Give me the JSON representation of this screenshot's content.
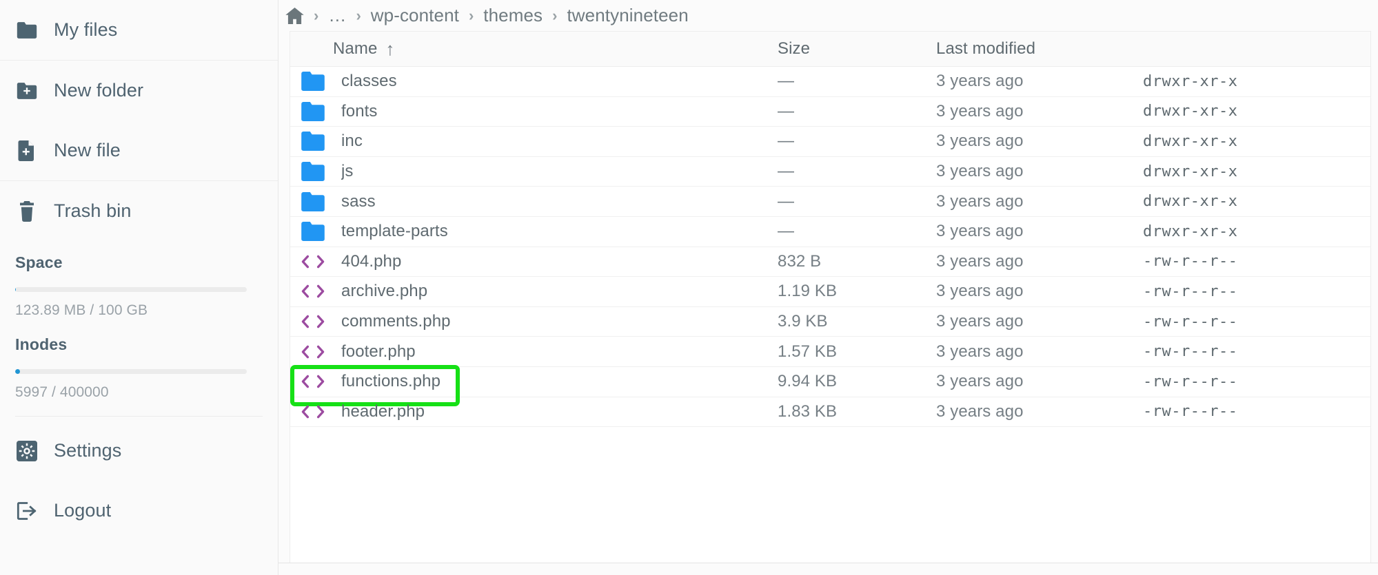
{
  "sidebar": {
    "groups": [
      {
        "items": [
          {
            "label": "My files",
            "icon": "folder-icon"
          }
        ]
      },
      {
        "items": [
          {
            "label": "New folder",
            "icon": "folder-plus-icon"
          },
          {
            "label": "New file",
            "icon": "file-plus-icon"
          }
        ]
      },
      {
        "items": [
          {
            "label": "Trash bin",
            "icon": "trash-icon"
          }
        ]
      }
    ],
    "meters": [
      {
        "title": "Space",
        "text": "123.89 MB / 100 GB",
        "percent": 0.12,
        "color": "#2196d4"
      },
      {
        "title": "Inodes",
        "text": "5997 / 400000",
        "percent": 1.5,
        "color": "#2196d4"
      }
    ],
    "footer": [
      {
        "label": "Settings",
        "icon": "gear-icon"
      },
      {
        "label": "Logout",
        "icon": "logout-icon"
      }
    ]
  },
  "breadcrumb": {
    "home_icon": "home-icon",
    "separator": "›",
    "items": [
      "…",
      "wp-content",
      "themes",
      "twentynineteen"
    ]
  },
  "table": {
    "headers": {
      "name": "Name",
      "sort_arrow": "↑",
      "size": "Size",
      "modified": "Last modified",
      "permissions": ""
    },
    "rows": [
      {
        "name": "classes",
        "icon": "folder-icon",
        "size": "—",
        "modified": "3 years ago",
        "permissions": "drwxr-xr-x",
        "highlighted": false
      },
      {
        "name": "fonts",
        "icon": "folder-icon",
        "size": "—",
        "modified": "3 years ago",
        "permissions": "drwxr-xr-x",
        "highlighted": false
      },
      {
        "name": "inc",
        "icon": "folder-icon",
        "size": "—",
        "modified": "3 years ago",
        "permissions": "drwxr-xr-x",
        "highlighted": false
      },
      {
        "name": "js",
        "icon": "folder-icon",
        "size": "—",
        "modified": "3 years ago",
        "permissions": "drwxr-xr-x",
        "highlighted": false
      },
      {
        "name": "sass",
        "icon": "folder-icon",
        "size": "—",
        "modified": "3 years ago",
        "permissions": "drwxr-xr-x",
        "highlighted": false
      },
      {
        "name": "template-parts",
        "icon": "folder-icon",
        "size": "—",
        "modified": "3 years ago",
        "permissions": "drwxr-xr-x",
        "highlighted": false
      },
      {
        "name": "404.php",
        "icon": "code-icon",
        "size": "832 B",
        "modified": "3 years ago",
        "permissions": "-rw-r--r--",
        "highlighted": false
      },
      {
        "name": "archive.php",
        "icon": "code-icon",
        "size": "1.19 KB",
        "modified": "3 years ago",
        "permissions": "-rw-r--r--",
        "highlighted": false
      },
      {
        "name": "comments.php",
        "icon": "code-icon",
        "size": "3.9 KB",
        "modified": "3 years ago",
        "permissions": "-rw-r--r--",
        "highlighted": false
      },
      {
        "name": "footer.php",
        "icon": "code-icon",
        "size": "1.57 KB",
        "modified": "3 years ago",
        "permissions": "-rw-r--r--",
        "highlighted": false
      },
      {
        "name": "functions.php",
        "icon": "code-icon",
        "size": "9.94 KB",
        "modified": "3 years ago",
        "permissions": "-rw-r--r--",
        "highlighted": true
      },
      {
        "name": "header.php",
        "icon": "code-icon",
        "size": "1.83 KB",
        "modified": "3 years ago",
        "permissions": "-rw-r--r--",
        "highlighted": false
      }
    ]
  },
  "colors": {
    "folder_blue": "#2196f3",
    "code_purple": "#9c4ba0",
    "highlight_green": "#16e016",
    "meter_blue": "#2196d4",
    "sidebar_icon": "#4d6471"
  }
}
